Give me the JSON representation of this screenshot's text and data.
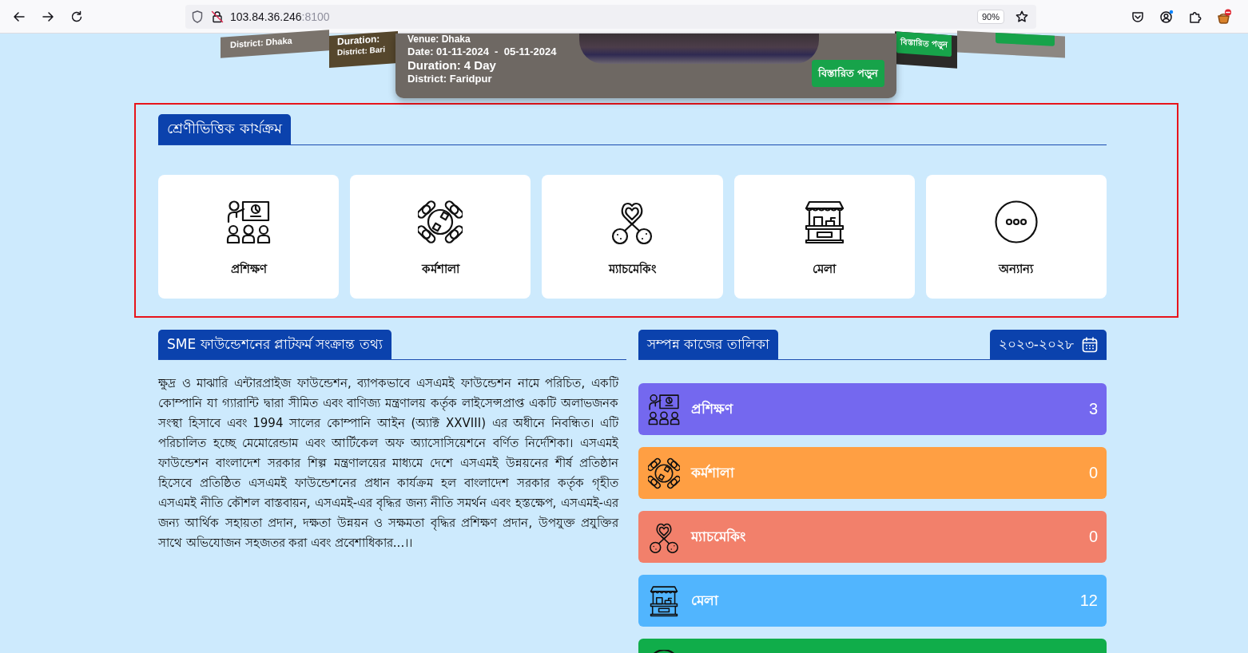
{
  "browser": {
    "url_host": "103.84.36.246",
    "url_port": ":8100",
    "zoom": "90%"
  },
  "carousel": {
    "side_slides": [
      {
        "kind": "far-left",
        "district": "District: Dhaka"
      },
      {
        "kind": "near-left",
        "duration": "Duration:",
        "district": "District: Bari"
      },
      {
        "kind": "near-right",
        "button": "বিস্তারিত পড়ুন"
      },
      {
        "kind": "far-right",
        "button_stub": true
      }
    ],
    "main_slide": {
      "venue": "Venue: Dhaka",
      "date": "Date: 01-11-2024  -  05-11-2024",
      "duration": "Duration: 4 Day",
      "district": "District: Faridpur",
      "button": "বিস্তারিত পড়ুন"
    }
  },
  "categories": {
    "highlighted": true,
    "title": "শ্রেণীভিত্তিক কার্যক্রম",
    "items": [
      {
        "kind": "training",
        "label": "প্রশিক্ষণ"
      },
      {
        "kind": "workshop",
        "label": "কর্মশালা"
      },
      {
        "kind": "matchmaking",
        "label": "ম্যাচমেকিং"
      },
      {
        "kind": "fair",
        "label": "মেলা"
      },
      {
        "kind": "other",
        "label": "অন্যান্য"
      }
    ]
  },
  "platform_info": {
    "title": "SME ফাউন্ডেশনের প্লাটফর্ম সংক্রান্ত তথ্য",
    "text": "ক্ষুদ্র ও মাঝারি এন্টারপ্রাইজ ফাউন্ডেশন, ব্যাপকভাবে এসএমই ফাউন্ডেশন নামে পরিচিত, একটি কোম্পানি যা গ্যারান্টি দ্বারা সীমিত এবং বাণিজ্য মন্ত্রণালয় কর্তৃক লাইসেন্সপ্রাপ্ত একটি অলাভজনক সংস্থা হিসাবে এবং 1994 সালের কোম্পানি আইন (অ্যাক্ট XXVIII) এর অধীনে নিবন্ধিত। এটি পরিচালিত হচ্ছে মেমোরেন্ডাম এবং আর্টিকেল অফ অ্যাসোসিয়েশনে বর্ণিত নির্দেশিকা। এসএমই ফাউন্ডেশন বাংলাদেশ সরকার শিল্প মন্ত্রণালয়ের মাধ্যমে দেশে এসএমই উন্নয়নের শীর্ষ প্রতিষ্ঠান হিসেবে প্রতিষ্ঠিত এসএমই ফাউন্ডেশনের প্রধান কার্যক্রম হল বাংলাদেশ সরকার কর্তৃক গৃহীত এসএমই নীতি কৌশল বাস্তবায়ন, এসএমই-এর বৃদ্ধির জন্য নীতি সমর্থন এবং হস্তক্ষেপ, এসএমই-এর জন্য আর্থিক সহায়তা প্রদান, দক্ষতা উন্নয়ন ও সক্ষমতা বৃদ্ধির প্রশিক্ষণ প্রদান, উপযুক্ত প্রযুক্তির সাথে অভিযোজন সহজতর করা এবং প্রবেশাধিকার...।।"
  },
  "completed_work": {
    "title": "সম্পন্ন কাজের তালিকা",
    "period": "২০২৩-২০২৮",
    "items": [
      {
        "kind": "training",
        "label": "প্রশিক্ষণ",
        "count": "3",
        "color": "#7468ef"
      },
      {
        "kind": "workshop",
        "label": "কর্মশালা",
        "count": "0",
        "color": "#ff9f43"
      },
      {
        "kind": "matchmaking",
        "label": "ম্যাচমেকিং",
        "count": "0",
        "color": "#f2806b"
      },
      {
        "kind": "fair",
        "label": "মেলা",
        "count": "12",
        "color": "#51b5fe"
      },
      {
        "kind": "other",
        "color": "#10ad4a"
      }
    ]
  }
}
